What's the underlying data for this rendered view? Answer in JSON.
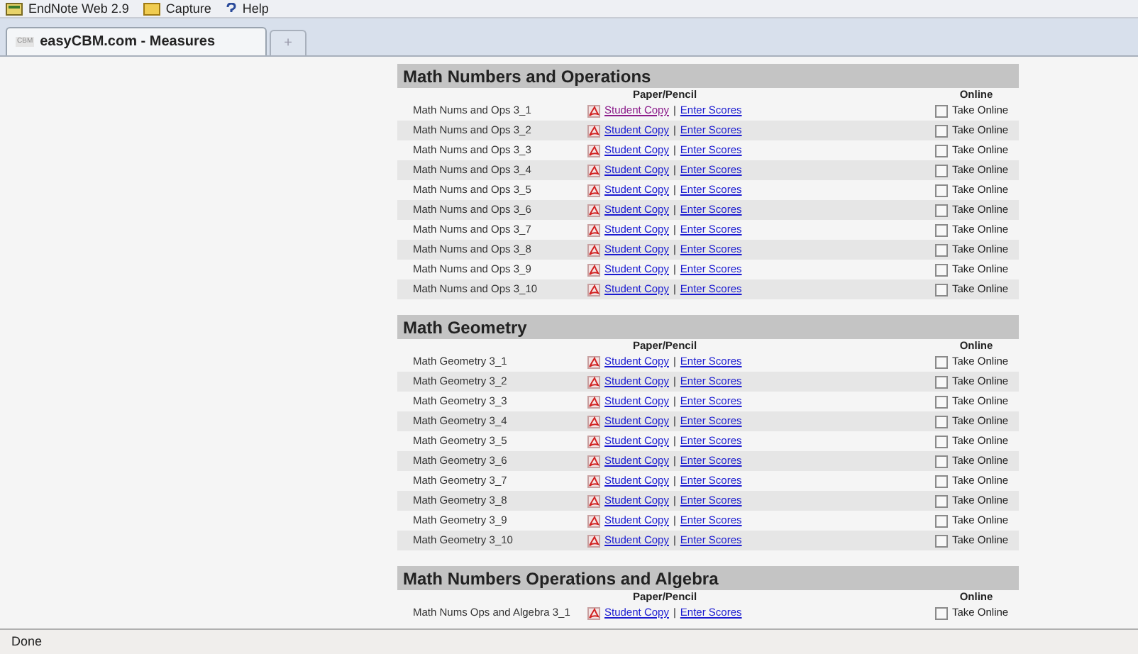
{
  "toolbar": {
    "items": [
      {
        "kind": "endnote",
        "label": "EndNote Web 2.9"
      },
      {
        "kind": "capture",
        "label": "Capture"
      },
      {
        "kind": "help",
        "label": "Help"
      }
    ]
  },
  "tabs": [
    {
      "favicon_text": "CBM",
      "label": "easyCBM.com - Measures",
      "selected": true
    }
  ],
  "new_tab": {
    "label": "+"
  },
  "sections": [
    {
      "title": "Math Numbers and Operations",
      "paper_header": "Paper/Pencil",
      "online_header": "Online",
      "rows": [
        {
          "name": "Math Nums and Ops 3_1",
          "student_copy": "Student Copy",
          "visited": true,
          "separator": "|",
          "enter_scores": "Enter Scores",
          "online_label": "Take Online",
          "checked": false
        },
        {
          "name": "Math Nums and Ops 3_2",
          "student_copy": "Student Copy",
          "visited": false,
          "separator": "|",
          "enter_scores": "Enter Scores",
          "online_label": "Take Online",
          "checked": false
        },
        {
          "name": "Math Nums and Ops 3_3",
          "student_copy": "Student Copy",
          "visited": false,
          "separator": "|",
          "enter_scores": "Enter Scores",
          "online_label": "Take Online",
          "checked": false
        },
        {
          "name": "Math Nums and Ops 3_4",
          "student_copy": "Student Copy",
          "visited": false,
          "separator": "|",
          "enter_scores": "Enter Scores",
          "online_label": "Take Online",
          "checked": false
        },
        {
          "name": "Math Nums and Ops 3_5",
          "student_copy": "Student Copy",
          "visited": false,
          "separator": "|",
          "enter_scores": "Enter Scores",
          "online_label": "Take Online",
          "checked": false
        },
        {
          "name": "Math Nums and Ops 3_6",
          "student_copy": "Student Copy",
          "visited": false,
          "separator": "|",
          "enter_scores": "Enter Scores",
          "online_label": "Take Online",
          "checked": false
        },
        {
          "name": "Math Nums and Ops 3_7",
          "student_copy": "Student Copy",
          "visited": false,
          "separator": "|",
          "enter_scores": "Enter Scores",
          "online_label": "Take Online",
          "checked": false
        },
        {
          "name": "Math Nums and Ops 3_8",
          "student_copy": "Student Copy",
          "visited": false,
          "separator": "|",
          "enter_scores": "Enter Scores",
          "online_label": "Take Online",
          "checked": false
        },
        {
          "name": "Math Nums and Ops 3_9",
          "student_copy": "Student Copy",
          "visited": false,
          "separator": "|",
          "enter_scores": "Enter Scores",
          "online_label": "Take Online",
          "checked": false
        },
        {
          "name": "Math Nums and Ops 3_10",
          "student_copy": "Student Copy",
          "visited": false,
          "separator": "|",
          "enter_scores": "Enter Scores",
          "online_label": "Take Online",
          "checked": false
        }
      ]
    },
    {
      "title": "Math Geometry",
      "paper_header": "Paper/Pencil",
      "online_header": "Online",
      "rows": [
        {
          "name": "Math Geometry 3_1",
          "student_copy": "Student Copy",
          "visited": false,
          "separator": "|",
          "enter_scores": "Enter Scores",
          "online_label": "Take Online",
          "checked": false
        },
        {
          "name": "Math Geometry 3_2",
          "student_copy": "Student Copy",
          "visited": false,
          "separator": "|",
          "enter_scores": "Enter Scores",
          "online_label": "Take Online",
          "checked": false
        },
        {
          "name": "Math Geometry 3_3",
          "student_copy": "Student Copy",
          "visited": false,
          "separator": "|",
          "enter_scores": "Enter Scores",
          "online_label": "Take Online",
          "checked": false
        },
        {
          "name": "Math Geometry 3_4",
          "student_copy": "Student Copy",
          "visited": false,
          "separator": "|",
          "enter_scores": "Enter Scores",
          "online_label": "Take Online",
          "checked": false
        },
        {
          "name": "Math Geometry 3_5",
          "student_copy": "Student Copy",
          "visited": false,
          "separator": "|",
          "enter_scores": "Enter Scores",
          "online_label": "Take Online",
          "checked": false
        },
        {
          "name": "Math Geometry 3_6",
          "student_copy": "Student Copy",
          "visited": false,
          "separator": "|",
          "enter_scores": "Enter Scores",
          "online_label": "Take Online",
          "checked": false
        },
        {
          "name": "Math Geometry 3_7",
          "student_copy": "Student Copy",
          "visited": false,
          "separator": "|",
          "enter_scores": "Enter Scores",
          "online_label": "Take Online",
          "checked": false
        },
        {
          "name": "Math Geometry 3_8",
          "student_copy": "Student Copy",
          "visited": false,
          "separator": "|",
          "enter_scores": "Enter Scores",
          "online_label": "Take Online",
          "checked": false
        },
        {
          "name": "Math Geometry 3_9",
          "student_copy": "Student Copy",
          "visited": false,
          "separator": "|",
          "enter_scores": "Enter Scores",
          "online_label": "Take Online",
          "checked": false
        },
        {
          "name": "Math Geometry 3_10",
          "student_copy": "Student Copy",
          "visited": false,
          "separator": "|",
          "enter_scores": "Enter Scores",
          "online_label": "Take Online",
          "checked": false
        }
      ]
    },
    {
      "title": "Math Numbers Operations and Algebra",
      "paper_header": "Paper/Pencil",
      "online_header": "Online",
      "rows": [
        {
          "name": "Math Nums Ops and Algebra 3_1",
          "student_copy": "Student Copy",
          "visited": false,
          "separator": "|",
          "enter_scores": "Enter Scores",
          "online_label": "Take Online",
          "checked": false
        }
      ]
    }
  ],
  "status_bar": {
    "text": "Done"
  }
}
